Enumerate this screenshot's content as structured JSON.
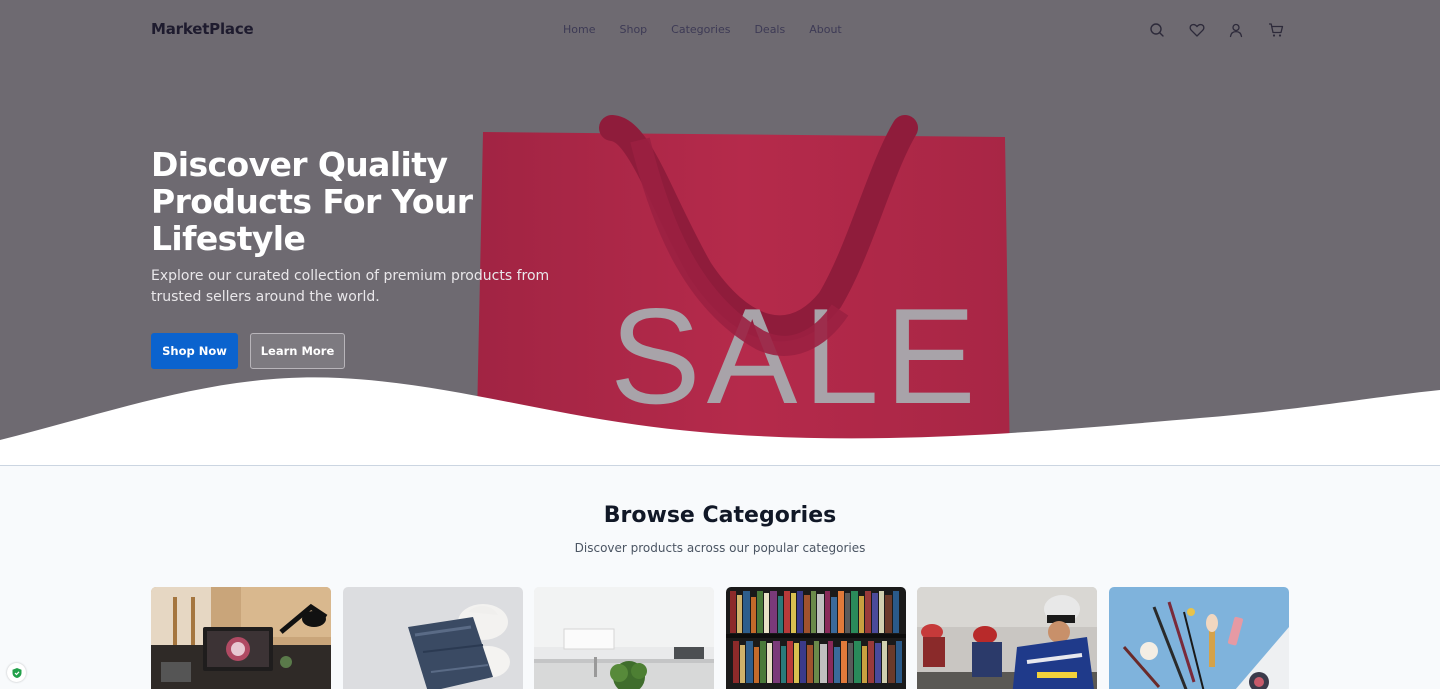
{
  "nav": {
    "logo": "MarketPlace",
    "links": [
      "Home",
      "Shop",
      "Categories",
      "Deals",
      "About"
    ],
    "icons": [
      "search-icon",
      "heart-icon",
      "user-icon",
      "cart-icon"
    ]
  },
  "hero": {
    "title": "Discover Quality Products For Your Lifestyle",
    "subtitle": "Explore our curated collection of premium products from trusted sellers around the world.",
    "primary_button": "Shop Now",
    "secondary_button": "Learn More",
    "image_text": "SALE"
  },
  "categories": {
    "title": "Browse Categories",
    "subtitle": "Discover products across our popular categories",
    "items": [
      {
        "image": "electronics-desk-photo"
      },
      {
        "image": "clothing-fabric-photo"
      },
      {
        "image": "home-kitchen-photo"
      },
      {
        "image": "bookshelf-photo"
      },
      {
        "image": "cyclists-photo"
      },
      {
        "image": "makeup-brushes-photo"
      }
    ]
  },
  "colors": {
    "accent": "#0b63ce",
    "hero_overlay": "#6e6a71",
    "bag_red": "#b1274a"
  }
}
